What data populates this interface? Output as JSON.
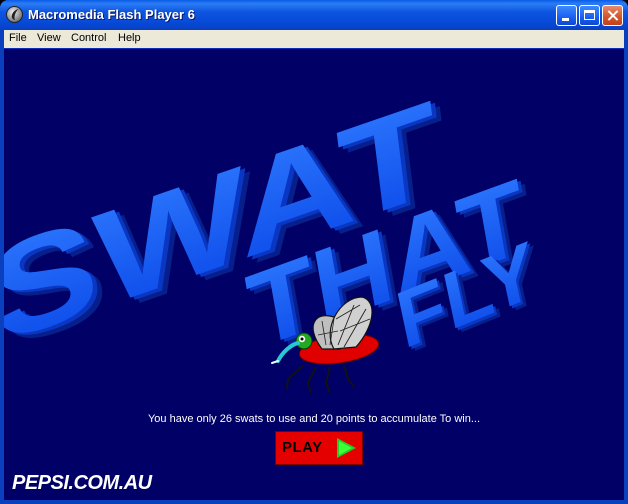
{
  "window": {
    "title": "Macromedia Flash Player 6",
    "icon": "flash-player-icon",
    "controls": [
      "minimize-icon",
      "maximize-icon",
      "close-icon"
    ]
  },
  "menu": {
    "items": [
      {
        "label": "File"
      },
      {
        "label": "View"
      },
      {
        "label": "Control"
      },
      {
        "label": "Help"
      }
    ]
  },
  "game": {
    "title_words": [
      "SWAT",
      "THAT",
      "FLY"
    ],
    "instructions": "You have only 26 swats to use and 20 points to accumulate To win...",
    "play_label": "PLAY",
    "brand": "PEPSI.COM.AU",
    "colors": {
      "background": "#000066",
      "title_blue": "#0a4dff",
      "play_red": "#e50000",
      "play_arrow": "#20d020"
    }
  }
}
